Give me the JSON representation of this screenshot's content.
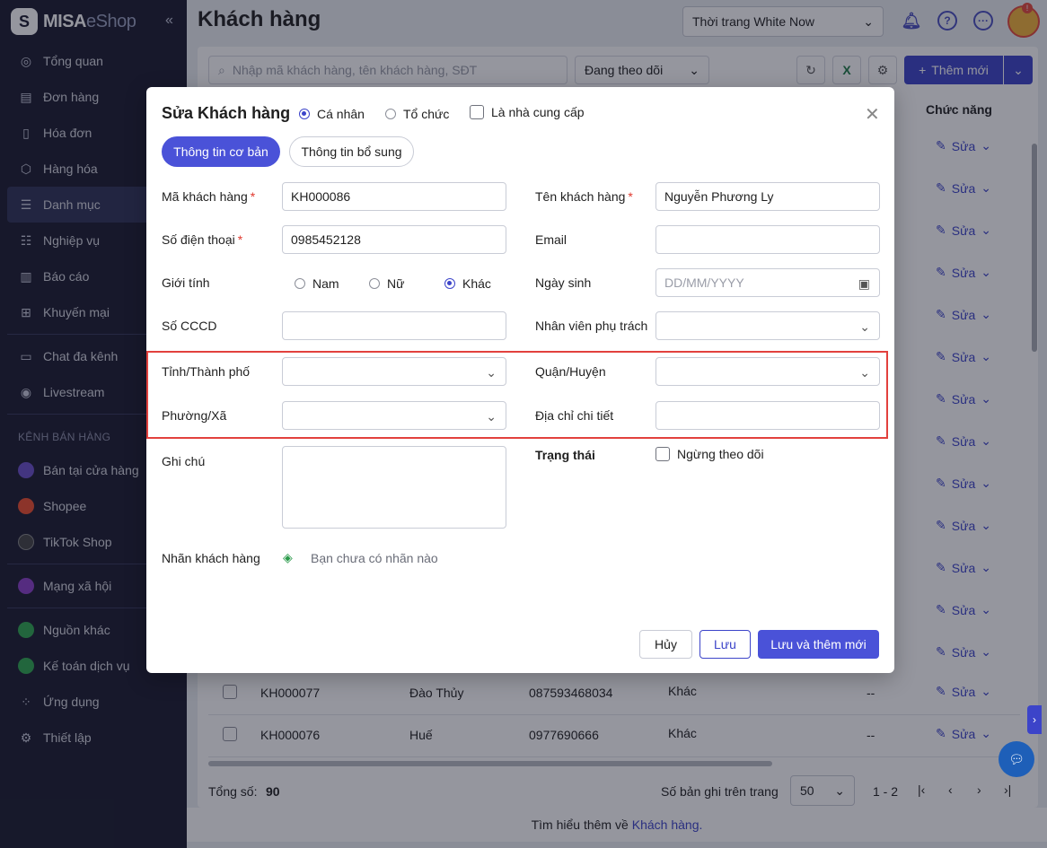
{
  "app": {
    "brand": "MISA",
    "brand_suffix": "eShop"
  },
  "sidebar": {
    "items": [
      {
        "label": "Tổng quan",
        "icon": "dashboard-icon"
      },
      {
        "label": "Đơn hàng",
        "icon": "order-icon"
      },
      {
        "label": "Hóa đơn",
        "icon": "invoice-icon"
      },
      {
        "label": "Hàng hóa",
        "icon": "box-icon"
      },
      {
        "label": "Danh mục",
        "icon": "list-icon",
        "active": true
      },
      {
        "label": "Nghiệp vụ",
        "icon": "workflow-icon"
      },
      {
        "label": "Báo cáo",
        "icon": "chart-icon"
      },
      {
        "label": "Khuyến mại",
        "icon": "gift-icon"
      }
    ],
    "items2": [
      {
        "label": "Chat đa kênh",
        "icon": "chat-icon"
      },
      {
        "label": "Livestream",
        "icon": "livestream-icon"
      }
    ],
    "section_title": "KÊNH BÁN HÀNG",
    "channels": [
      {
        "label": "Bán tại cửa hàng",
        "color": "#6b4fc9"
      },
      {
        "label": "Shopee",
        "color": "#ee4d2d"
      },
      {
        "label": "TikTok Shop",
        "color": "#222222"
      }
    ],
    "social": {
      "label": "Mạng xã hội",
      "color": "#8a3fc9"
    },
    "items3": [
      {
        "label": "Nguồn khác",
        "color": "#2fa84f"
      },
      {
        "label": "Kế toán dịch vụ",
        "color": "#2fa84f"
      }
    ],
    "items4": [
      {
        "label": "Ứng dụng",
        "icon": "apps-icon"
      },
      {
        "label": "Thiết lập",
        "icon": "settings-icon"
      }
    ]
  },
  "header": {
    "title": "Khách hàng",
    "store": "Thời trang White Now",
    "avatar_badge": "!"
  },
  "toolbar": {
    "search_placeholder": "Nhập mã khách hàng, tên khách hàng, SĐT",
    "follow_filter": "Đang theo dõi",
    "add_label": "Thêm mới"
  },
  "table": {
    "col_function": "Chức năng",
    "edit_label": "Sửa",
    "rows": [
      {
        "code": "KH000077",
        "name": "Đào Thủy",
        "phone": "087593468034",
        "gender": "Khác",
        "extra": "--"
      },
      {
        "code": "KH000076",
        "name": "Huế",
        "phone": "0977690666",
        "gender": "Khác",
        "extra": "--"
      }
    ]
  },
  "footer": {
    "total_label": "Tổng số:",
    "total_value": "90",
    "per_page_label": "Số bản ghi trên trang",
    "per_page_value": "50",
    "range": "1 - 2"
  },
  "learn_more": {
    "text": "Tìm hiểu thêm về",
    "link": "Khách hàng."
  },
  "modal": {
    "title": "Sửa Khách hàng",
    "type_personal": "Cá nhân",
    "type_org": "Tổ chức",
    "is_supplier": "Là nhà cung cấp",
    "tab_basic": "Thông tin cơ bản",
    "tab_extra": "Thông tin bổ sung",
    "fields": {
      "code_label": "Mã khách hàng",
      "code_value": "KH000086",
      "name_label": "Tên khách hàng",
      "name_value": "Nguyễn Phương Ly",
      "phone_label": "Số điện thoại",
      "phone_value": "0985452128",
      "email_label": "Email",
      "email_value": "",
      "gender_label": "Giới tính",
      "gender_male": "Nam",
      "gender_female": "Nữ",
      "gender_other": "Khác",
      "birth_label": "Ngày sinh",
      "birth_placeholder": "DD/MM/YYYY",
      "id_label": "Số CCCD",
      "staff_label": "Nhân viên phụ trách",
      "province_label": "Tỉnh/Thành phố",
      "district_label": "Quận/Huyện",
      "ward_label": "Phường/Xã",
      "address_label": "Địa chỉ chi tiết",
      "note_label": "Ghi chú",
      "status_label": "Trạng thái",
      "status_stop": "Ngừng theo dõi",
      "tag_label": "Nhãn khách hàng",
      "tag_empty": "Bạn chưa có nhãn nào"
    },
    "buttons": {
      "cancel": "Hủy",
      "save": "Lưu",
      "save_new": "Lưu và thêm mới"
    }
  },
  "colors": {
    "primary": "#4a52d8",
    "sidebar_bg": "#1a1b2e",
    "highlight": "#e2413d"
  }
}
